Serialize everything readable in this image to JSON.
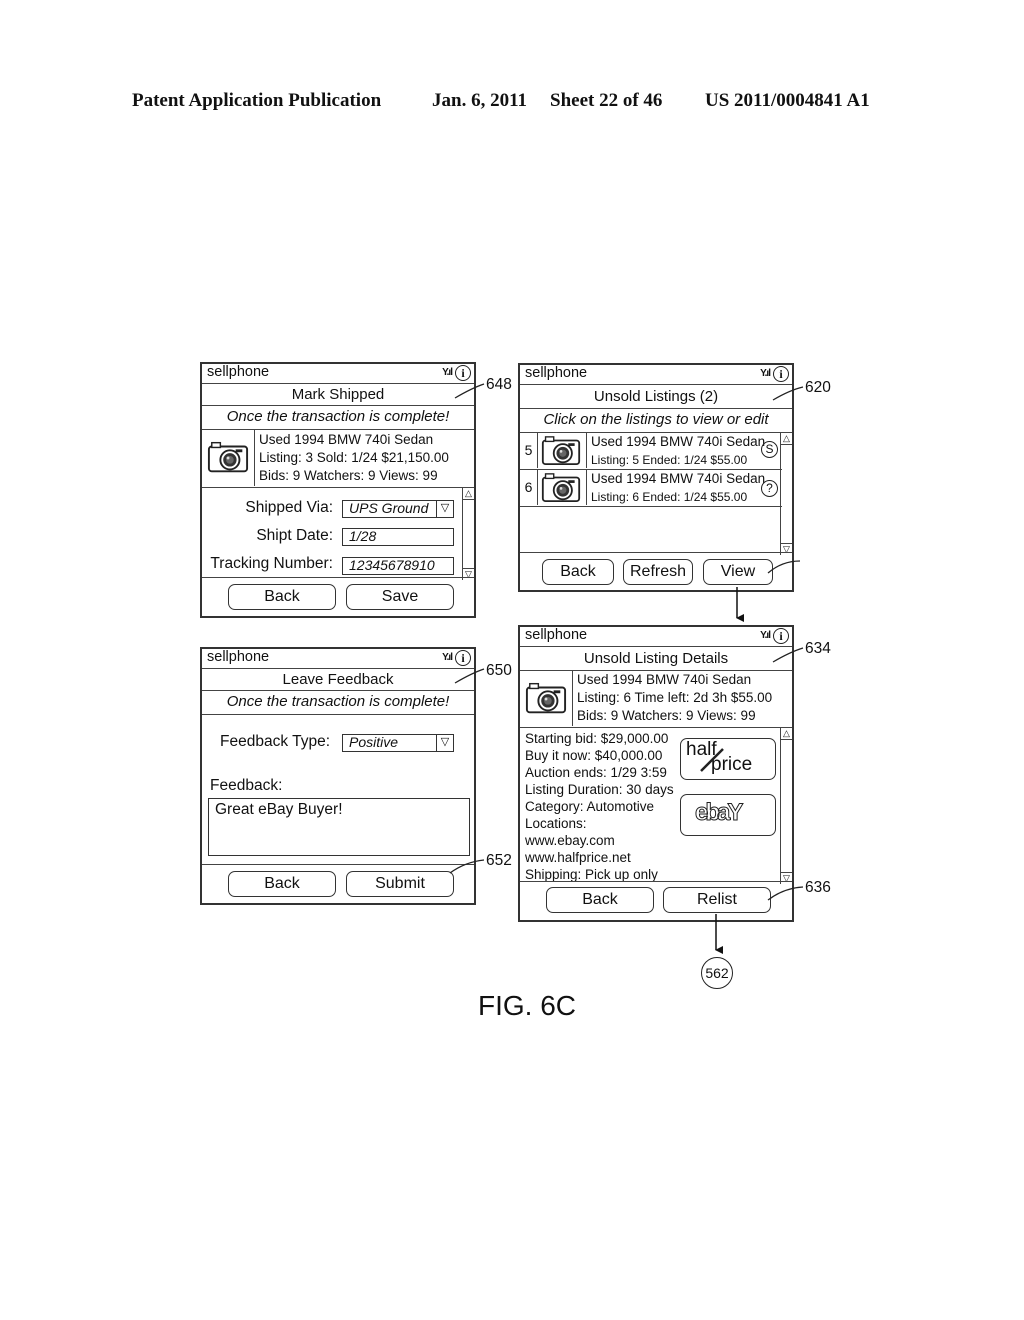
{
  "header": {
    "publication": "Patent Application Publication",
    "date": "Jan. 6, 2011",
    "sheet": "Sheet 22 of 46",
    "number": "US 2011/0004841 A1"
  },
  "common": {
    "app_name": "sellphone",
    "signal_glyph": "Y.ıl",
    "info_glyph": "i",
    "scroll_up": "△",
    "scroll_down": "▽",
    "dropdown_glyph": "▽"
  },
  "mark_shipped": {
    "ref": "648",
    "title": "Mark Shipped",
    "subtitle": "Once the transaction is complete!",
    "item": {
      "line1": "Used 1994 BMW 740i Sedan",
      "line2": "Listing: 3   Sold:  1/24   $21,150.00",
      "line3": "Bids: 9   Watchers: 9   Views: 99"
    },
    "fields": [
      {
        "label": "Shipped Via:",
        "value": "UPS Ground",
        "type": "dropdown"
      },
      {
        "label": "Shipt Date:",
        "value": "1/28",
        "type": "text"
      },
      {
        "label": "Tracking Number:",
        "value": "12345678910",
        "type": "text"
      }
    ],
    "buttons": {
      "back": "Back",
      "save": "Save"
    }
  },
  "leave_feedback": {
    "ref": "650",
    "button_ref": "652",
    "title": "Leave Feedback",
    "subtitle": "Once the transaction is complete!",
    "feedback_type_label": "Feedback Type:",
    "feedback_type_value": "Positive",
    "feedback_label": "Feedback:",
    "feedback_text": "Great eBay Buyer!",
    "buttons": {
      "back": "Back",
      "submit": "Submit"
    }
  },
  "unsold_listings": {
    "ref": "620",
    "title": "Unsold Listings (2)",
    "subtitle": "Click on the listings to view or edit",
    "items": [
      {
        "index": "5",
        "line1": "Used 1994 BMW 740i Sedan",
        "line2": "Listing: 5   Ended:  1/24   $55.00",
        "status_glyph": "S"
      },
      {
        "index": "6",
        "line1": "Used 1994 BMW 740i Sedan",
        "line2": "Listing: 6   Ended:  1/24   $55.00",
        "status_glyph": "?"
      }
    ],
    "buttons": {
      "back": "Back",
      "refresh": "Refresh",
      "view": "View"
    }
  },
  "unsold_details": {
    "ref": "634",
    "button_ref": "636",
    "title": "Unsold Listing Details",
    "item": {
      "line1": "Used 1994 BMW 740i Sedan",
      "line2": "Listing: 6   Time left:  2d 3h   $55.00",
      "line3": "Bids: 9   Watchers: 9   Views: 99"
    },
    "details": [
      "Starting bid:  $29,000.00",
      "Buy it now:  $40,000.00",
      "Auction ends:  1/29   3:59",
      "Listing Duration:  30 days",
      "Category:  Automotive",
      "Locations:",
      "www.ebay.com",
      "www.halfprice.net",
      "Shipping:  Pick up only"
    ],
    "logos": {
      "halfprice_top": "half",
      "halfprice_bottom": "price",
      "ebay": "ebaY"
    },
    "buttons": {
      "back": "Back",
      "relist": "Relist"
    }
  },
  "connector": "562",
  "figure_label": "FIG. 6C"
}
